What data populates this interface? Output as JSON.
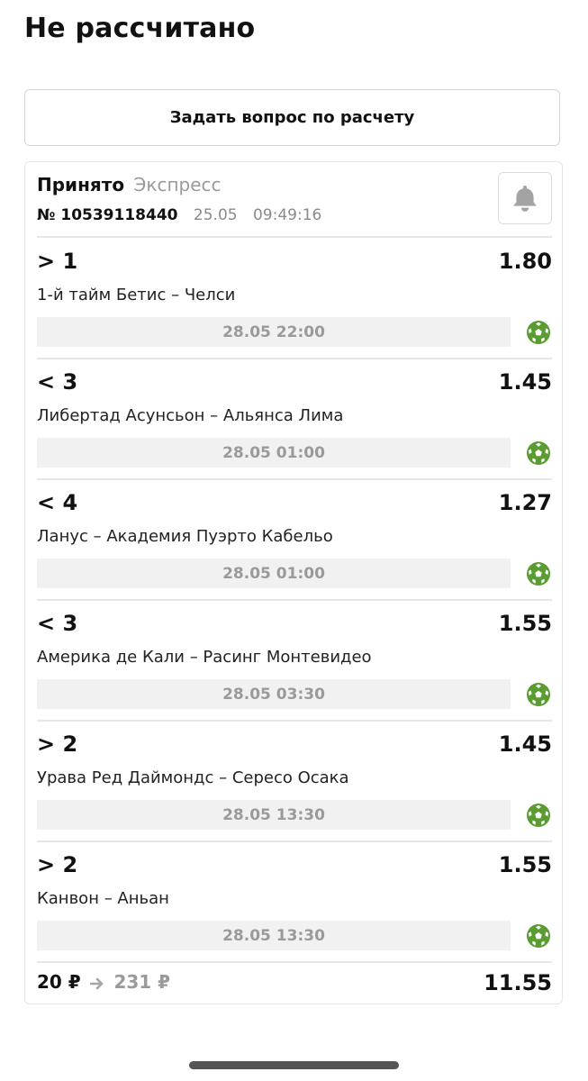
{
  "page": {
    "title": "Не рассчитано"
  },
  "ask_button": {
    "label": "Задать вопрос по расчету"
  },
  "bet": {
    "status": "Принято",
    "type": "Экспресс",
    "number": "№ 10539118440",
    "date": "25.05",
    "time": "09:49:16",
    "bell_icon": "bell-icon"
  },
  "legs": [
    {
      "selection": "> 1",
      "odds": "1.80",
      "event": "1-й тайм Бетис – Челси",
      "start": "28.05 22:00",
      "sport_icon": "soccer-ball-icon"
    },
    {
      "selection": "< 3",
      "odds": "1.45",
      "event": "Либертад Асунсьон – Альянса Лима",
      "start": "28.05 01:00",
      "sport_icon": "soccer-ball-icon"
    },
    {
      "selection": "< 4",
      "odds": "1.27",
      "event": "Ланус – Академия Пуэрто Кабельо",
      "start": "28.05 01:00",
      "sport_icon": "soccer-ball-icon"
    },
    {
      "selection": "< 3",
      "odds": "1.55",
      "event": "Америка де Кали – Расинг Монтевидео",
      "start": "28.05 03:30",
      "sport_icon": "soccer-ball-icon"
    },
    {
      "selection": "> 2",
      "odds": "1.45",
      "event": "Урава Ред Даймондс – Сересо Осака",
      "start": "28.05 13:30",
      "sport_icon": "soccer-ball-icon"
    },
    {
      "selection": "> 2",
      "odds": "1.55",
      "event": "Канвон – Аньан",
      "start": "28.05 13:30",
      "sport_icon": "soccer-ball-icon"
    }
  ],
  "footer": {
    "stake": "20 ₽",
    "payout": "231 ₽",
    "total_odds": "11.55",
    "arrow_icon": "arrow-right-icon"
  },
  "colors": {
    "sport_icon": "#5a9b32",
    "muted_text": "#9a9a9a",
    "date_bg": "#f1f1f1"
  }
}
